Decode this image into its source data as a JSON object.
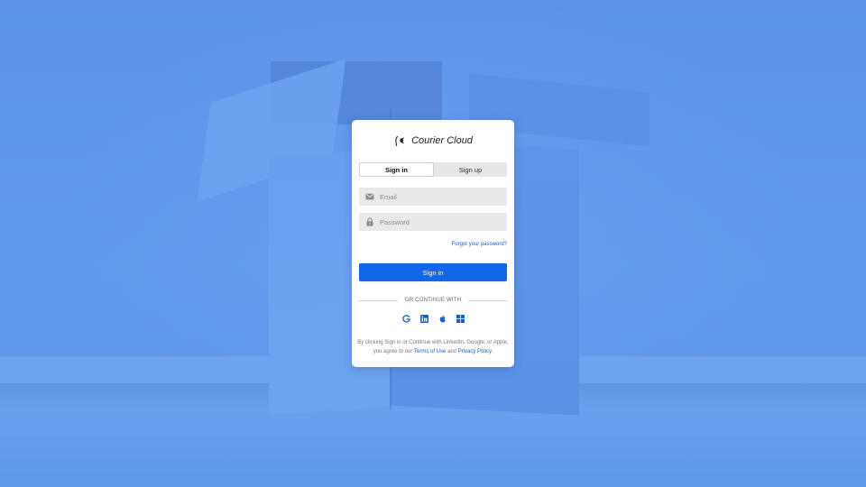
{
  "brand": {
    "name": "Courier Cloud",
    "logo_icon": "quill-logo-icon"
  },
  "auth_tabs": {
    "signin_label": "Sign in",
    "signup_label": "Sign up",
    "active": "signin"
  },
  "form": {
    "email": {
      "value": "",
      "placeholder": "Email",
      "icon": "mail-icon"
    },
    "password": {
      "value": "",
      "placeholder": "Password",
      "icon": "lock-icon"
    },
    "forgot_link": "Forgot your password?",
    "submit_label": "Sign in"
  },
  "divider_text": "OR CONTINUE WITH",
  "social": [
    {
      "name": "google",
      "icon": "google-icon"
    },
    {
      "name": "linkedin",
      "icon": "linkedin-icon"
    },
    {
      "name": "apple",
      "icon": "apple-icon"
    },
    {
      "name": "microsoft",
      "icon": "windows-icon"
    }
  ],
  "legal": {
    "prefix": "By clicking Sign in or Continue with LinkedIn, Google, or Apple, you agree to our ",
    "terms": "Terms of Use",
    "and": " and ",
    "privacy": "Privacy Policy",
    "suffix": "."
  },
  "colors": {
    "background": "#5e95ea",
    "accent": "#1366e5",
    "link": "#1a5fc6",
    "card": "#ffffff"
  }
}
